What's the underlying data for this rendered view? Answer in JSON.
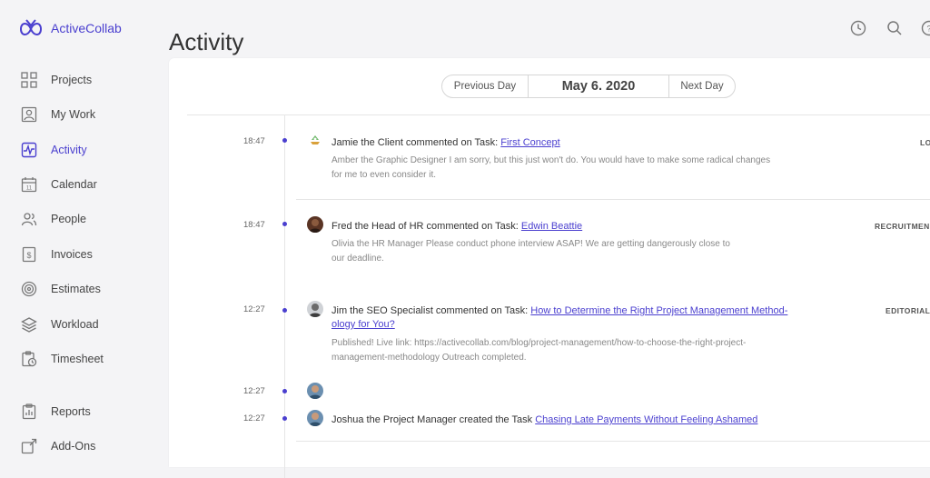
{
  "app": {
    "name": "ActiveCollab"
  },
  "sidebar": {
    "items": [
      {
        "label": "Projects",
        "icon": "grid-icon"
      },
      {
        "label": "My Work",
        "icon": "user-card-icon"
      },
      {
        "label": "Activity",
        "icon": "activity-icon",
        "active": true
      },
      {
        "label": "Calendar",
        "icon": "calendar-icon"
      },
      {
        "label": "People",
        "icon": "people-icon"
      },
      {
        "label": "Invoices",
        "icon": "invoice-icon"
      },
      {
        "label": "Estimates",
        "icon": "target-icon"
      },
      {
        "label": "Workload",
        "icon": "layers-icon"
      },
      {
        "label": "Timesheet",
        "icon": "clipboard-clock-icon"
      },
      {
        "label": "Reports",
        "icon": "report-icon"
      },
      {
        "label": "Add-Ons",
        "icon": "addons-icon"
      }
    ]
  },
  "header": {
    "title": "Activity"
  },
  "day_nav": {
    "prev": "Previous Day",
    "date": "May 6. 2020",
    "next": "Next Day"
  },
  "entries": [
    {
      "time": "18:47",
      "prefix": "Jamie the Client commented on Task: ",
      "link": "First Concept",
      "desc1": "Amber the Graphic Designer I am sorry, but this just won't do. You would have to make some radical changes",
      "desc2": "for me to even consider it.",
      "tag": "LO"
    },
    {
      "time": "18:47",
      "prefix": "Fred the Head of HR commented on Task: ",
      "link": "Edwin Beattie",
      "desc1": "Olivia the HR Manager Please conduct phone interview ASAP! We are getting dangerously close to",
      "desc2": "our deadline.",
      "tag": "RECRUITMEN"
    },
    {
      "time": "12:27",
      "prefix": "Jim the SEO Specialist commented on Task: ",
      "link": "How to Determine the Right Project Management Method-",
      "link2": "ology for You?",
      "desc1": "Published! Live link: https://activecollab.com/blog/project-management/how-to-choose-the-right-project-",
      "desc2": "management-methodology Outreach completed.",
      "tag": "EDITORIAL"
    },
    {
      "time": "12:27"
    },
    {
      "time": "12:27",
      "prefix": "Joshua the Project Manager created the Task ",
      "link": "Chasing Late Payments Without Feeling Ashamed"
    }
  ],
  "colors": {
    "accent": "#4a3fcf",
    "background": "#f4f4f6"
  }
}
